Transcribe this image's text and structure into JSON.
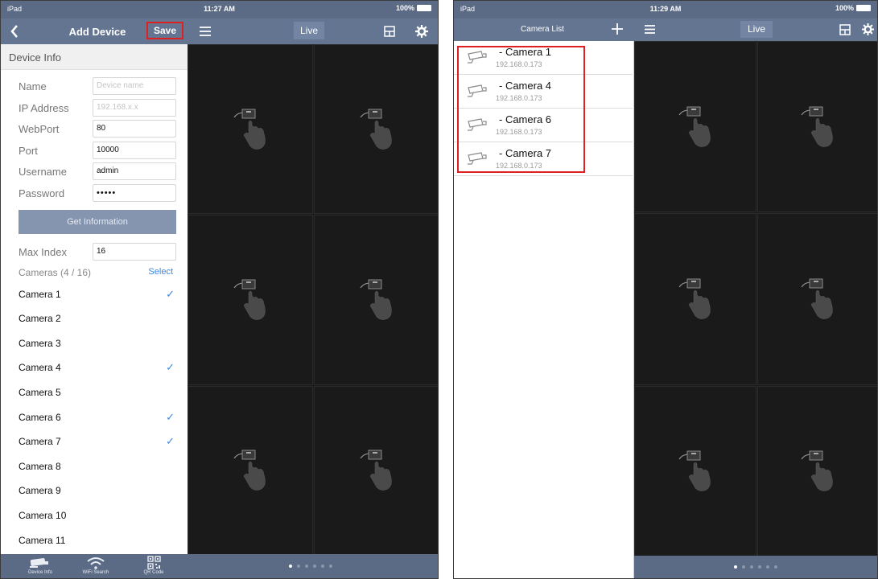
{
  "left": {
    "status": {
      "device": "iPad",
      "time": "11:27 AM",
      "battery": "100%"
    },
    "nav": {
      "title": "Add Device",
      "save_label": "Save",
      "live_label": "Live"
    },
    "section_header": "Device Info",
    "fields": [
      {
        "label": "Name",
        "value": "",
        "placeholder": "Device name"
      },
      {
        "label": "IP Address",
        "value": "",
        "placeholder": "192.168.x.x"
      },
      {
        "label": "WebPort",
        "value": "80",
        "placeholder": ""
      },
      {
        "label": "Port",
        "value": "10000",
        "placeholder": ""
      },
      {
        "label": "Username",
        "value": "admin",
        "placeholder": ""
      },
      {
        "label": "Password",
        "value": "•••••",
        "placeholder": ""
      }
    ],
    "get_info_label": "Get Information",
    "max_index": {
      "label": "Max Index",
      "value": "16"
    },
    "cameras_header": {
      "label": "Cameras (4 / 16)",
      "select_label": "Select"
    },
    "cameras": [
      {
        "name": "Camera 1",
        "checked": true
      },
      {
        "name": "Camera 2",
        "checked": false
      },
      {
        "name": "Camera 3",
        "checked": false
      },
      {
        "name": "Camera 4",
        "checked": true
      },
      {
        "name": "Camera 5",
        "checked": false
      },
      {
        "name": "Camera 6",
        "checked": true
      },
      {
        "name": "Camera 7",
        "checked": true
      },
      {
        "name": "Camera 8",
        "checked": false
      },
      {
        "name": "Camera 9",
        "checked": false
      },
      {
        "name": "Camera 10",
        "checked": false
      },
      {
        "name": "Camera 11",
        "checked": false
      }
    ],
    "tabs": [
      {
        "label": "Device Info",
        "icon": "camera-icon"
      },
      {
        "label": "WiFi Search",
        "icon": "wifi-icon"
      },
      {
        "label": "QR Code",
        "icon": "qr-code-icon"
      }
    ]
  },
  "right": {
    "status": {
      "device": "iPad",
      "time": "11:29 AM",
      "battery": "100%"
    },
    "nav": {
      "title": "Camera List",
      "live_label": "Live"
    },
    "cameras": [
      {
        "name": "- Camera 1",
        "ip": "192.168.0.173"
      },
      {
        "name": "- Camera 4",
        "ip": "192.168.0.173"
      },
      {
        "name": "- Camera 6",
        "ip": "192.168.0.173"
      },
      {
        "name": "- Camera 7",
        "ip": "192.168.0.173"
      }
    ]
  },
  "colors": {
    "navbar": "#647592",
    "accent": "#3b86e0",
    "highlight": "#e02020",
    "grid_bg": "#1a1a1a"
  }
}
